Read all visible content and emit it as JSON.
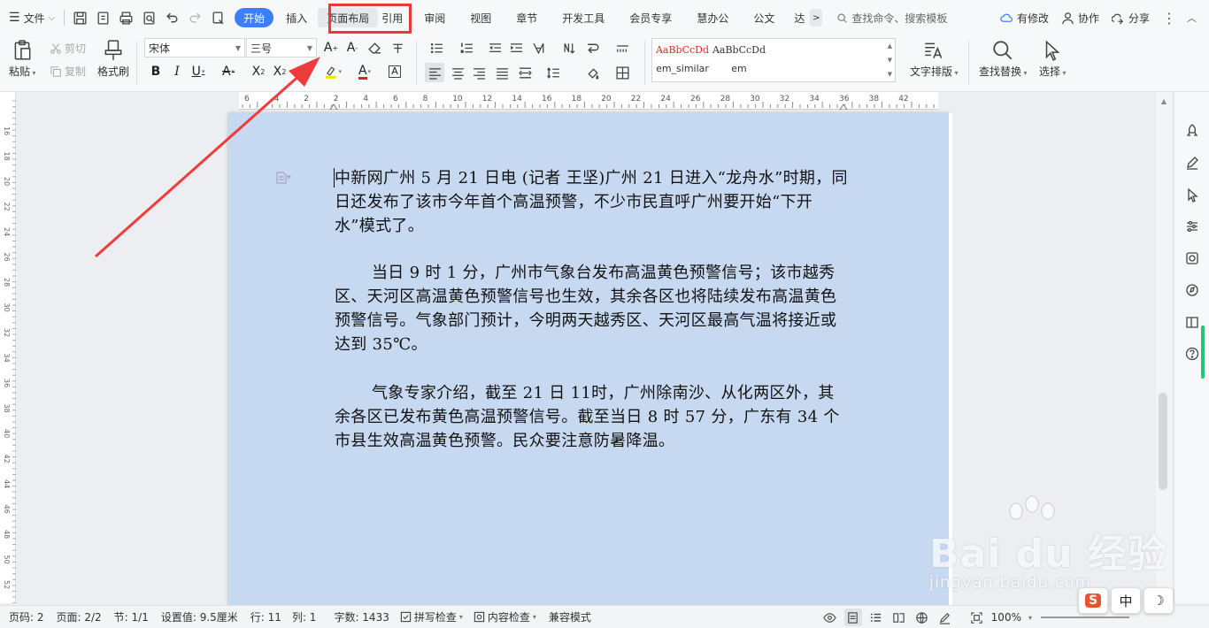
{
  "menubar": {
    "file_label": "文件",
    "tabs": [
      "开始",
      "插入",
      "页面布局",
      "引用",
      "审阅",
      "视图",
      "章节",
      "开发工具",
      "会员专享",
      "慧办公",
      "公文",
      "达"
    ],
    "more": ">",
    "search_placeholder": "查找命令、搜索模板",
    "right": {
      "modify": "有修改",
      "collab": "协作",
      "share": "分享",
      "kebab": "⋮",
      "collapse": "︿"
    }
  },
  "toolbar": {
    "paste": "粘贴",
    "cut": "剪切",
    "copy": "复制",
    "format_painter": "格式刷",
    "font_name": "宋体",
    "font_size": "三号",
    "styles": [
      {
        "preview": "AaBbCcDd",
        "name": "em_similar"
      },
      {
        "preview": "AaBbCcDd",
        "name": "em"
      }
    ],
    "text_layout": "文字排版",
    "find_replace": "查找替换",
    "select": "选择"
  },
  "ruler": {
    "top_ticks": [
      "6",
      "4",
      "2",
      "2",
      "4",
      "6",
      "8",
      "10",
      "12",
      "14",
      "16",
      "18",
      "20",
      "22",
      "24",
      "26",
      "28",
      "30",
      "32",
      "34",
      "36",
      "38",
      "42"
    ],
    "left_ticks": [
      "16",
      "18",
      "20",
      "22",
      "24",
      "26",
      "28",
      "30",
      "32",
      "34",
      "36",
      "38",
      "40",
      "42",
      "44",
      "46",
      "48",
      "50",
      "52"
    ]
  },
  "document": {
    "paragraphs": [
      "中新网广州 5 月 21 日电 (记者 王坚)广州 21 日进入“龙舟水”时期，同日还发布了该市今年首个高温预警，不少市民直呼广州要开始“下开水”模式了。",
      "当日 9 时 1 分，广州市气象台发布高温黄色预警信号；该市越秀区、天河区高温黄色预警信号也生效，其余各区也将陆续发布高温黄色预警信号。气象部门预计，今明两天越秀区、天河区最高气温将接近或达到 35℃。",
      "气象专家介绍，截至 21 日 11时，广州除南沙、从化两区外，其余各区已发布黄色高温预警信号。截至当日 8 时 57 分，广东有 34 个市县生效高温黄色预警。民众要注意防暑降温。"
    ]
  },
  "statusbar": {
    "page_num": "页码: 2",
    "pages": "页面: 2/2",
    "section": "节: 1/1",
    "setting": "设置值: 9.5厘米",
    "row": "行: 11",
    "col": "列: 1",
    "words": "字数: 1433",
    "spell": "拼写检查",
    "content_check": "内容检查",
    "compat": "兼容模式",
    "zoom": "100%"
  },
  "ime": {
    "sogou": "S",
    "lang": "中",
    "moon": "☽"
  },
  "watermark": {
    "text": "Bai du 经验",
    "url": "jingyan.baidu.com"
  },
  "colors": {
    "accent": "#3d7ff8",
    "page": "#c7d9f1",
    "highlight": "#e83a3a",
    "green": "#28c37a"
  }
}
